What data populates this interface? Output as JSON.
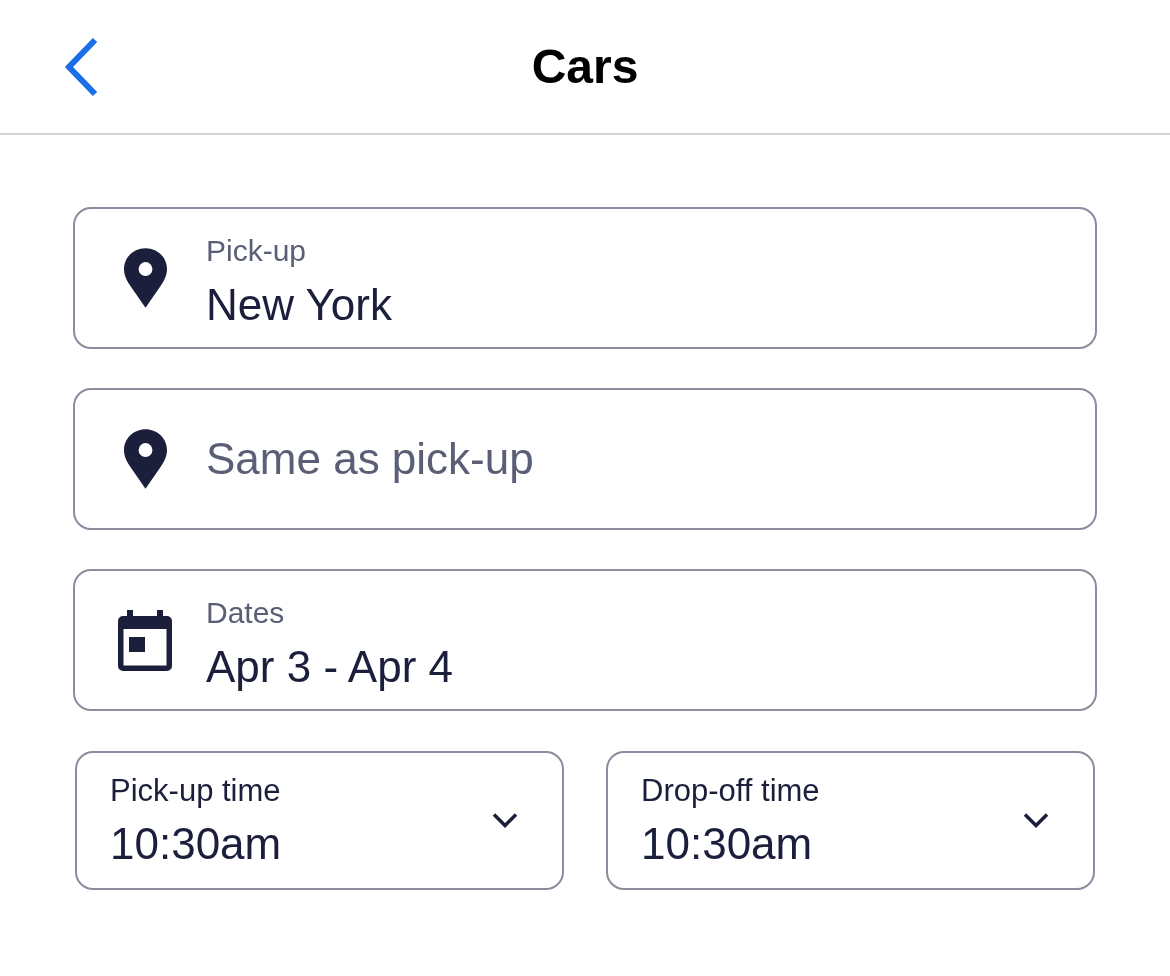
{
  "header": {
    "title": "Cars"
  },
  "fields": [
    {
      "kind": "location",
      "label": "Pick-up",
      "value": "New York"
    },
    {
      "kind": "location",
      "placeholder": "Same as pick-up"
    },
    {
      "kind": "date",
      "label": "Dates",
      "value": "Apr 3 - Apr 4"
    }
  ],
  "time_selects": [
    {
      "label": "Pick-up time",
      "value": "10:30am"
    },
    {
      "label": "Drop-off time",
      "value": "10:30am"
    }
  ]
}
